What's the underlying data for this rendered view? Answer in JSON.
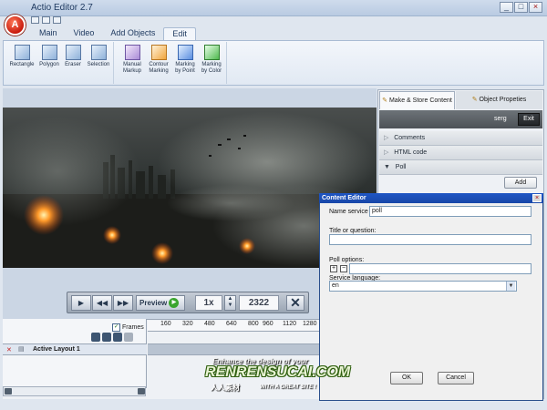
{
  "app": {
    "title": "Actio Editor 2.7",
    "logo_letter": "A"
  },
  "window": {
    "minimize": "_",
    "maximize": "□",
    "close": "×"
  },
  "ribbon": {
    "tabs": [
      "Main",
      "Video",
      "Add Objects",
      "Edit"
    ],
    "active_tab": "Edit",
    "tools": [
      {
        "label": "Rectangle",
        "icon": "rectangle-tool-icon"
      },
      {
        "label": "Polygon",
        "icon": "polygon-tool-icon"
      },
      {
        "label": "Eraser",
        "icon": "eraser-tool-icon"
      },
      {
        "label": "Selection",
        "icon": "selection-tool-icon"
      }
    ],
    "markup": [
      {
        "line1": "Manual",
        "line2": "Markup",
        "icon": "manual-markup-icon"
      },
      {
        "line1": "Contour",
        "line2": "Marking",
        "icon": "contour-marking-icon"
      },
      {
        "line1": "Marking",
        "line2": "by Point",
        "icon": "marking-point-icon"
      },
      {
        "line1": "Marking",
        "line2": "by Color",
        "icon": "marking-color-icon"
      }
    ]
  },
  "player": {
    "preview_label": "Preview",
    "speed": "1x",
    "frame": "2322",
    "buttons": [
      "play-icon",
      "rewind-icon",
      "fast-forward-icon"
    ]
  },
  "timeline": {
    "frames_label": "Frames",
    "frames_checked": true,
    "ruler": [
      "160",
      "320",
      "480",
      "640",
      "800",
      "960",
      "1120",
      "1280"
    ],
    "layer_name": "Active Layout 1"
  },
  "right_panel": {
    "tabs": [
      "Make & Store Content",
      "Object Propeties"
    ],
    "active_tab": "Make & Store Content",
    "user": "serg",
    "exit_label": "Exit",
    "sections": [
      {
        "label": "Comments",
        "expanded": false
      },
      {
        "label": "HTML code",
        "expanded": false
      },
      {
        "label": "Poll",
        "expanded": true
      }
    ],
    "add_label": "Add"
  },
  "dialog": {
    "title": "Content Editor",
    "name_label": "Name service",
    "name_value": "poll",
    "question_label": "Title or question:",
    "question_value": "",
    "options_label": "Poll options:",
    "option_value": "",
    "language_label": "Service language:",
    "language_value": "en",
    "ok_label": "OK",
    "cancel_label": "Cancel"
  },
  "watermark": {
    "line1": "Enhance the design of your",
    "brand": "RENRENSUCAI.COM",
    "line2": "人人素材",
    "line3": "WITH A GREAT SITE !"
  }
}
